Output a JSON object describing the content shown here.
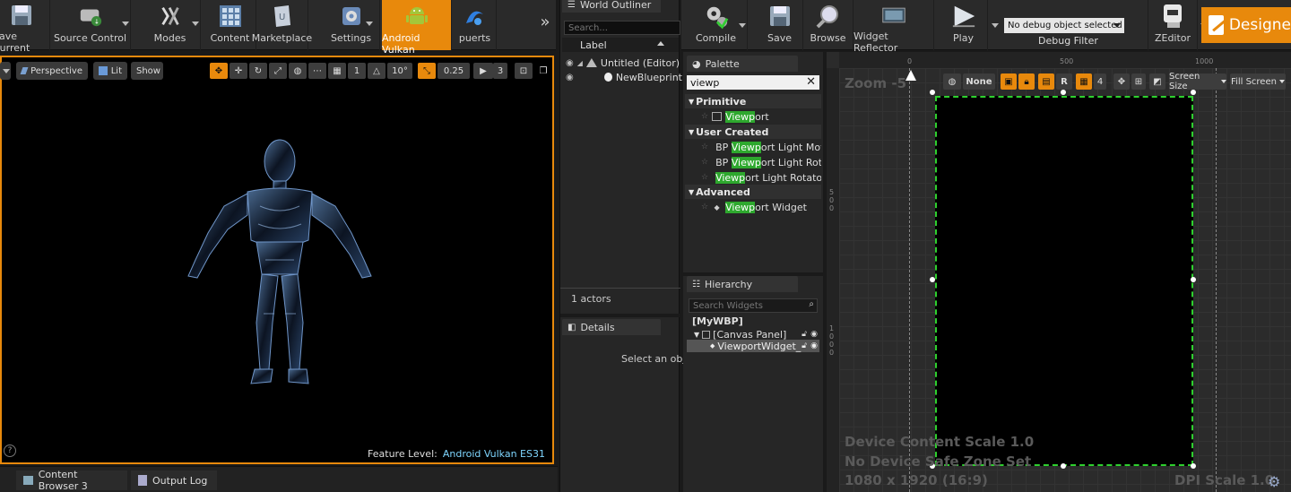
{
  "level_toolbar": {
    "save_current": "Save Current",
    "source_control": "Source Control",
    "modes": "Modes",
    "content": "Content",
    "marketplace": "Marketplace",
    "settings": "Settings",
    "android_vulkan": "Android Vulkan",
    "puerts": "puerts",
    "more": "»"
  },
  "viewport": {
    "perspective": "Perspective",
    "lit": "Lit",
    "show": "Show",
    "grid_snap": "1",
    "rotation_snap": "10°",
    "scale_snap": "0.25",
    "camera_speed": "3",
    "feature_level_label": "Feature Level:",
    "feature_level_value": "Android Vulkan ES31",
    "help": "?"
  },
  "bottom_tabs": {
    "content_browser": "Content Browser 3",
    "output_log": "Output Log"
  },
  "world_outliner": {
    "title": "World Outliner",
    "search_placeholder": "Search...",
    "column_label": "Label",
    "rows": [
      "Untitled (Editor)",
      "NewBlueprint"
    ],
    "actors_count": "1 actors"
  },
  "details": {
    "title": "Details",
    "empty_text": "Select an obje"
  },
  "bp_toolbar": {
    "compile": "Compile",
    "save": "Save",
    "browse": "Browse",
    "widget_reflector": "Widget Reflector",
    "play": "Play",
    "debug_select": "No debug object selected",
    "debug_filter": "Debug Filter",
    "zeditor": "ZEditor",
    "designer": "Designe"
  },
  "palette": {
    "title": "Palette",
    "search_value": "viewp",
    "categories": {
      "primitive": "Primitive",
      "user_created": "User Created",
      "advanced": "Advanced"
    },
    "items": {
      "viewport": {
        "pre": "",
        "hl": "Viewp",
        "post": "ort"
      },
      "bp_move": {
        "pre": "BP ",
        "hl": "Viewp",
        "post": "ort Light Move"
      },
      "bp_rota": {
        "pre": "BP ",
        "hl": "Viewp",
        "post": "ort Light Rota"
      },
      "light_rotator": {
        "pre": "",
        "hl": "Viewp",
        "post": "ort Light Rotator"
      },
      "viewport_widget": {
        "pre": "",
        "hl": "Viewp",
        "post": "ort Widget"
      }
    }
  },
  "hierarchy": {
    "title": "Hierarchy",
    "search_placeholder": "Search Widgets",
    "root": "[MyWBP]",
    "canvas": "[Canvas Panel]",
    "child": "ViewportWidget_"
  },
  "designer": {
    "zoom": "Zoom -5",
    "ruler_x": [
      "0",
      "500",
      "1000"
    ],
    "ruler_y_top": [
      "5",
      "0",
      "0"
    ],
    "ruler_y_mid": [
      "1",
      "0",
      "0",
      "0"
    ],
    "none_label": "None",
    "r_label": "R",
    "grid_value": "4",
    "screen_size": "Screen Size",
    "fill_screen": "Fill Screen",
    "device_content_scale": "Device Content Scale 1.0",
    "safe_zone": "No Device Safe Zone Set",
    "resolution": "1080 x 1920 (16:9)",
    "dpi_scale": "DPI Scale 1.0"
  },
  "colors": {
    "accent": "#e8890c",
    "highlight": "#2ea82e",
    "feature_level": "#7fd6ff"
  }
}
